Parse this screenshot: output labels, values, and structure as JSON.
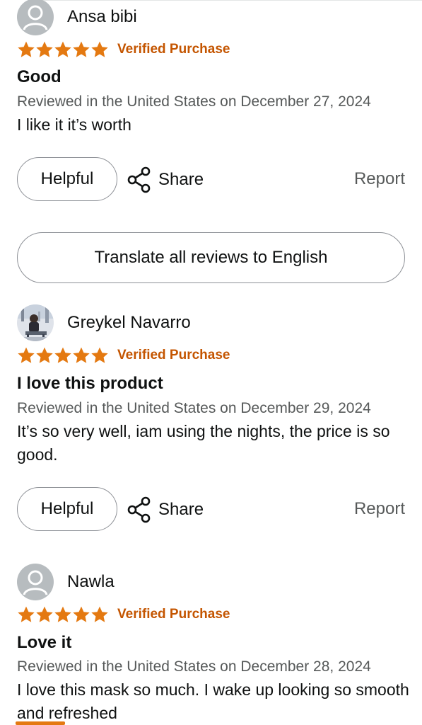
{
  "reviews": [
    {
      "name": "Ansa bibi",
      "avatar": "default-avatar",
      "rating": 5,
      "verified": "Verified Purchase",
      "title": "Good",
      "date": "Reviewed in the United States on December 27, 2024",
      "body": "I like it it’s worth",
      "helpful": "Helpful",
      "share": "Share",
      "report": "Report"
    },
    {
      "name": "Greykel Navarro",
      "avatar": "photo-avatar",
      "rating": 5,
      "verified": "Verified Purchase",
      "title": "I love this product",
      "date": "Reviewed in the United States on December 29, 2024",
      "body": "It’s so very well, iam using the nights, the price is so good.",
      "helpful": "Helpful",
      "share": "Share",
      "report": "Report"
    },
    {
      "name": "Nawla",
      "avatar": "default-avatar",
      "rating": 5,
      "verified": "Verified Purchase",
      "title": "Love it",
      "date": "Reviewed in the United States on December 28, 2024",
      "body": "I love this mask so much. I wake up looking so smooth and refreshed"
    }
  ],
  "translate": {
    "label": "Translate all reviews to English"
  },
  "colors": {
    "star": "#e47911",
    "verified": "#c45500",
    "muted": "#565959",
    "border": "#8d9096"
  }
}
